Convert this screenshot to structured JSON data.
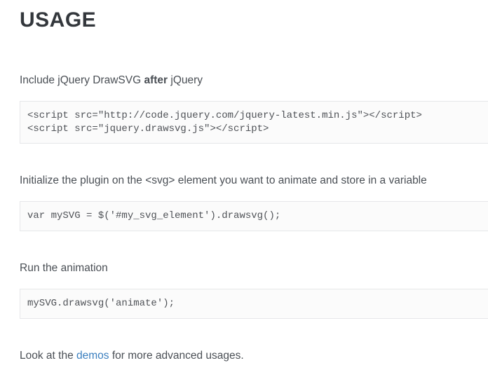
{
  "heading": "USAGE",
  "section1": {
    "pre": "Include jQuery DrawSVG ",
    "bold": "after",
    "post": " jQuery",
    "code": "<script src=\"http://code.jquery.com/jquery-latest.min.js\"></script>\n<script src=\"jquery.drawsvg.js\"></script>"
  },
  "section2": {
    "text": "Initialize the plugin on the <svg> element you want to animate and store in a variable",
    "code": "var mySVG = $('#my_svg_element').drawsvg();"
  },
  "section3": {
    "text": "Run the animation",
    "code": "mySVG.drawsvg('animate');"
  },
  "section4": {
    "pre": "Look at the ",
    "link": "demos",
    "post": " for more advanced usages."
  }
}
